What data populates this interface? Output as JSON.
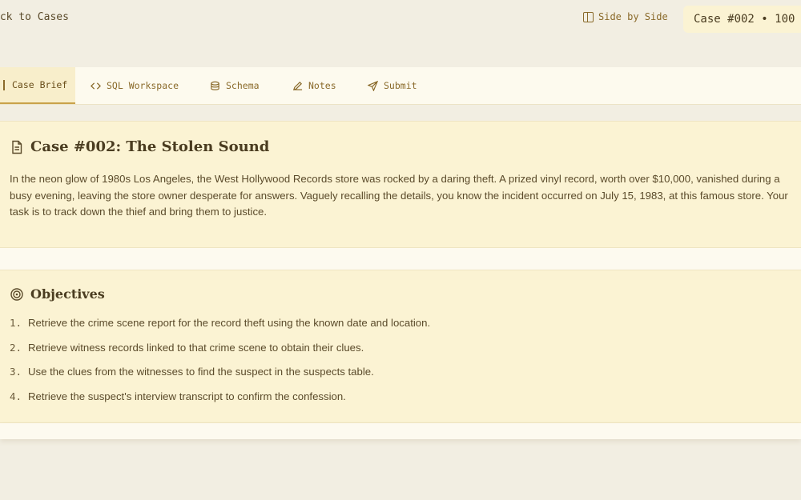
{
  "header": {
    "back_label": "ack to Cases",
    "side_by_side_label": "Side by Side",
    "case_badge": "Case #002 • 100"
  },
  "tabs": [
    {
      "label": "Case Brief",
      "icon": "document-icon",
      "active": true
    },
    {
      "label": "SQL Workspace",
      "icon": "code-icon",
      "active": false
    },
    {
      "label": "Schema",
      "icon": "database-icon",
      "active": false
    },
    {
      "label": "Notes",
      "icon": "pencil-icon",
      "active": false
    },
    {
      "label": "Submit",
      "icon": "send-icon",
      "active": false
    }
  ],
  "brief": {
    "title": "Case #002: The Stolen Sound",
    "text": "In the neon glow of 1980s Los Angeles, the West Hollywood Records store was rocked by a daring theft. A prized vinyl record, worth over $10,000, vanished during a busy evening, leaving the store owner desperate for answers. Vaguely recalling the details, you know the incident occurred on July 15, 1983, at this famous store. Your task is to track down the thief and bring them to justice."
  },
  "objectives": {
    "title": "Objectives",
    "items": [
      {
        "num": "1.",
        "text": "Retrieve the crime scene report for the record theft using the known date and location."
      },
      {
        "num": "2.",
        "text": "Retrieve witness records linked to that crime scene to obtain their clues."
      },
      {
        "num": "3.",
        "text": "Use the clues from the witnesses to find the suspect in the suspects table."
      },
      {
        "num": "4.",
        "text": "Retrieve the suspect's interview transcript to confirm the confession."
      }
    ]
  },
  "colors": {
    "background": "#f2eee2",
    "card": "#fbf3d3",
    "accent": "#c9a24a",
    "text": "#5a4a2a"
  }
}
